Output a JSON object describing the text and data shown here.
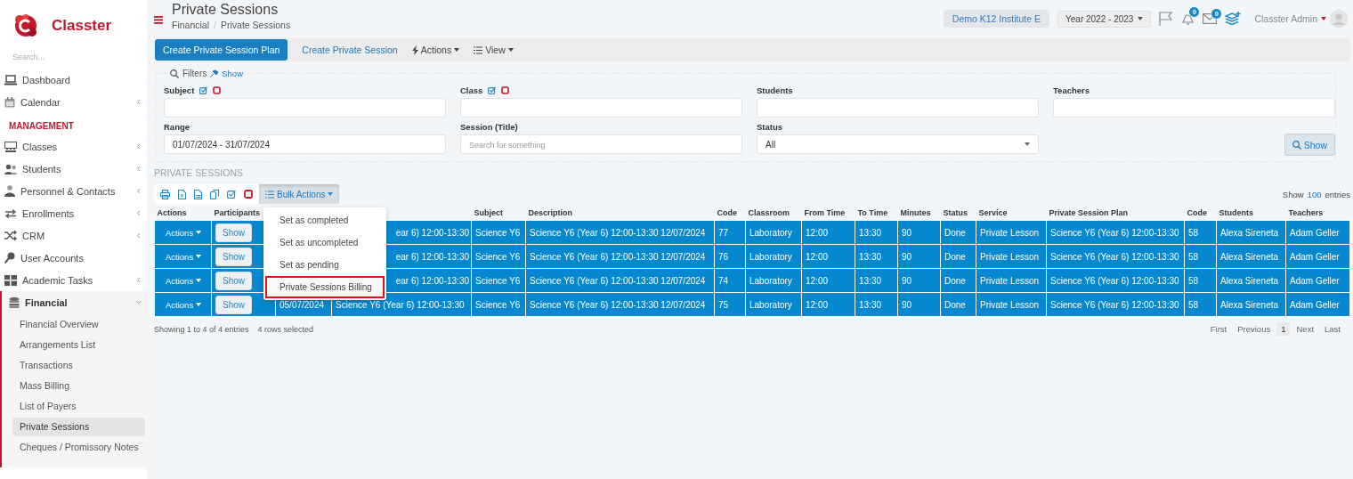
{
  "brand": {
    "name": "Classter"
  },
  "sidebar": {
    "search_placeholder": "Search...",
    "items": [
      {
        "kind": "link",
        "label": "Dashboard",
        "expandable": false
      },
      {
        "kind": "link",
        "label": "Calendar",
        "expandable": true
      },
      {
        "kind": "section",
        "label": "MANAGEMENT"
      },
      {
        "kind": "link",
        "label": "Classes",
        "expandable": true
      },
      {
        "kind": "link",
        "label": "Students",
        "expandable": true
      },
      {
        "kind": "link",
        "label": "Personnel & Contacts",
        "expandable": true
      },
      {
        "kind": "link",
        "label": "Enrollments",
        "expandable": true
      },
      {
        "kind": "link",
        "label": "CRM",
        "expandable": true
      },
      {
        "kind": "link",
        "label": "User Accounts",
        "expandable": false
      },
      {
        "kind": "link",
        "label": "Academic Tasks",
        "expandable": true
      },
      {
        "kind": "group",
        "label": "Financial",
        "expanded": true,
        "children": [
          {
            "label": "Financial Overview",
            "selected": false
          },
          {
            "label": "Arrangements List",
            "selected": false
          },
          {
            "label": "Transactions",
            "selected": false
          },
          {
            "label": "Mass Billing",
            "selected": false
          },
          {
            "label": "List of Payers",
            "selected": false
          },
          {
            "label": "Private Sessions",
            "selected": true
          },
          {
            "label": "Cheques / Promissory Notes",
            "selected": false
          }
        ]
      }
    ]
  },
  "header": {
    "title": "Private Sessions",
    "breadcrumb": [
      "Financial",
      "Private Sessions"
    ],
    "breadcrumb_separator": "/",
    "institute": "Demo K12 Institute E",
    "year": "Year 2022 - 2023",
    "notifications": "0",
    "messages": "0",
    "user": "Classter Admin"
  },
  "toolbar": [
    {
      "kind": "primary",
      "label": "Create Private Session Plan"
    },
    {
      "kind": "link",
      "label": "Create Private Session"
    },
    {
      "kind": "dropdown",
      "label": "Actions"
    },
    {
      "kind": "dropdown",
      "label": "View"
    }
  ],
  "filters": {
    "legend": "Filters",
    "toggle": "Show",
    "fields": [
      {
        "kind": "multi",
        "label": "Subject"
      },
      {
        "kind": "multi",
        "label": "Class"
      },
      {
        "kind": "text",
        "label": "Students"
      },
      {
        "kind": "text",
        "label": "Teachers"
      },
      {
        "kind": "text",
        "label": "Range",
        "value": "01/07/2024 - 31/07/2024"
      },
      {
        "kind": "text",
        "label": "Session (Title)",
        "placeholder": "Search for something"
      },
      {
        "kind": "select",
        "label": "Status",
        "value": "All"
      }
    ],
    "submit": "Show"
  },
  "table": {
    "title": "PRIVATE SESSIONS",
    "bulk_actions": {
      "label": "Bulk Actions",
      "expanded": true,
      "items": [
        {
          "label": "Set as completed",
          "highlighted": false
        },
        {
          "label": "Set as uncompleted",
          "highlighted": false
        },
        {
          "label": "Set as pending",
          "highlighted": false
        },
        {
          "label": "Private Sessions Billing",
          "highlighted": true
        }
      ]
    },
    "length": {
      "prefix": "Show",
      "value": "100",
      "suffix": "entries"
    },
    "columns": [
      "Actions",
      "Participants",
      null,
      null,
      "Subject",
      "Description",
      "Code",
      "Classroom",
      "From Time",
      "To Time",
      "Minutes",
      "Status",
      "Service",
      "Private Session Plan",
      "Code",
      "Students",
      "Teachers"
    ],
    "rows": [
      {
        "selected": true,
        "cells": [
          "Actions",
          "Show",
          null,
          {
            "text": "ear 6) 12:00-13:30",
            "clipped": true
          },
          "Science Y6",
          "Science Y6 (Year 6) 12:00-13:30 12/07/2024",
          "77",
          "Laboratory",
          "12:00",
          "13:30",
          "90",
          "Done",
          "Private Lesson",
          "Science Y6 (Year 6) 12:00-13:30",
          "58",
          "Alexa Sireneta",
          "Adam Geller"
        ]
      },
      {
        "selected": true,
        "cells": [
          "Actions",
          "Show",
          null,
          {
            "text": "ear 6) 12:00-13:30",
            "clipped": true
          },
          "Science Y6",
          "Science Y6 (Year 6) 12:00-13:30 12/07/2024",
          "76",
          "Laboratory",
          "12:00",
          "13:30",
          "90",
          "Done",
          "Private Lesson",
          "Science Y6 (Year 6) 12:00-13:30",
          "58",
          "Alexa Sireneta",
          "Adam Geller"
        ]
      },
      {
        "selected": true,
        "cells": [
          "Actions",
          "Show",
          null,
          {
            "text": "ear 6) 12:00-13:30",
            "clipped": true
          },
          "Science Y6",
          "Science Y6 (Year 6) 12:00-13:30 12/07/2024",
          "74",
          "Laboratory",
          "12:00",
          "13:30",
          "90",
          "Done",
          "Private Lesson",
          "Science Y6 (Year 6) 12:00-13:30",
          "58",
          "Alexa Sireneta",
          "Adam Geller"
        ]
      },
      {
        "selected": true,
        "cells": [
          "Actions",
          "Show",
          "05/07/2024",
          "Science Y6 (Year 6) 12:00-13:30",
          "Science Y6",
          "Science Y6 (Year 6) 12:00-13:30 12/07/2024",
          "75",
          "Laboratory",
          "12:00",
          "13:30",
          "90",
          "Done",
          "Private Lesson",
          "Science Y6 (Year 6) 12:00-13:30",
          "58",
          "Alexa Sireneta",
          "Adam Geller"
        ]
      }
    ],
    "info": "Showing 1 to 4 of 4 entries",
    "selection_info": "4 rows selected",
    "pagination": [
      {
        "label": "First",
        "selected": false
      },
      {
        "label": "Previous",
        "selected": false
      },
      {
        "label": "1",
        "selected": true
      },
      {
        "label": "Next",
        "selected": false
      },
      {
        "label": "Last",
        "selected": false
      }
    ]
  }
}
